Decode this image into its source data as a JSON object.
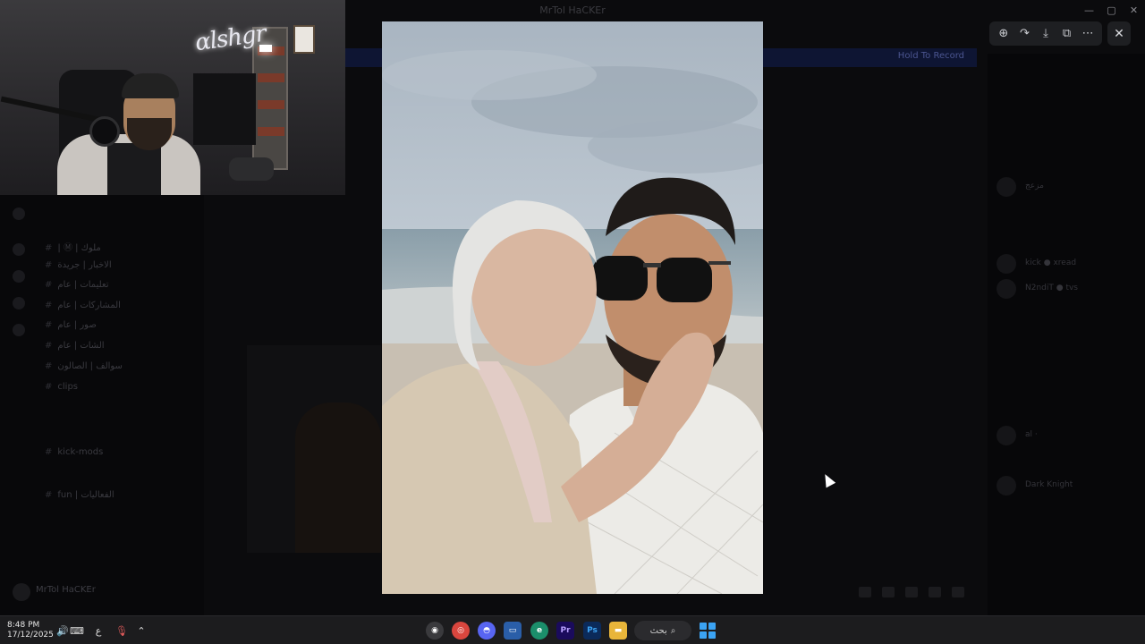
{
  "window": {
    "title": "MrTol HaCKEr",
    "controls": [
      "—",
      "▢",
      "✕"
    ]
  },
  "discord": {
    "banner_button": "Hold To Record",
    "channels": [
      "| Ⓜ | ملوك",
      "الاخبار | جريدة",
      "تعليمات | عام",
      "المشاركات | عام",
      "صور | عام",
      "الشات | عام",
      "سوالف | الصالون",
      "clips",
      "kick-mods",
      "fun | الفعاليات"
    ],
    "user_name": "MrTol HaCKEr",
    "members": [
      "مزعج",
      "kick ● xread",
      "N2ndiT ● tvs",
      "al ·",
      "Dark Knight"
    ]
  },
  "viewer": {
    "toolbar_icons": [
      "zoom-in-icon",
      "forward-icon",
      "download-icon",
      "open-external-icon",
      "more-icon"
    ],
    "close_icon": "close-icon"
  },
  "taskbar": {
    "time": "8:48 PM",
    "date": "17/12/2025",
    "lang": "ع",
    "search_label": "بحث",
    "apps": [
      {
        "name": "OBS",
        "color": "#3a3a3d"
      },
      {
        "name": "Chrome",
        "color": "#d9463e"
      },
      {
        "name": "Discord",
        "color": "#5865f2"
      },
      {
        "name": "Task View",
        "color": "#2a5ea8"
      },
      {
        "name": "Edge",
        "color": "#1b8f6b"
      },
      {
        "name": "Pr",
        "color": "#1a0b5c"
      },
      {
        "name": "Ps",
        "color": "#0b2a5a"
      },
      {
        "name": "Explorer",
        "color": "#e8b53a"
      }
    ]
  }
}
